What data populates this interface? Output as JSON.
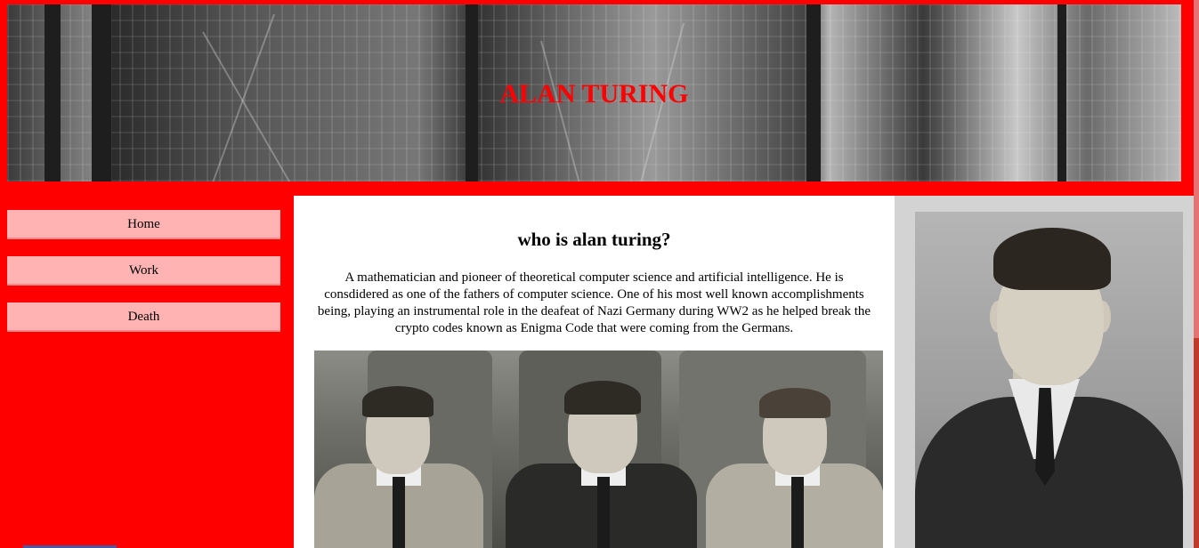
{
  "header": {
    "title": "ALAN TURING",
    "banner_image": "computer-machinery-photo"
  },
  "sidebar": {
    "items": [
      {
        "label": "Home"
      },
      {
        "label": "Work"
      },
      {
        "label": "Death"
      }
    ]
  },
  "main": {
    "heading": "who is alan turing?",
    "paragraph": "A mathematician and pioneer of theoretical computer science and artificial intelligence. He is consdidered as one of the fathers of computer science. One of his most well known accomplishments being, playing an instrumental role in the deafeat of Nazi Germany during WW2 as he helped break the crypto codes known as Enigma Code that were coming from the Germans.",
    "image": "school-group-photo"
  },
  "aside": {
    "image": "alan-turing-portrait"
  },
  "colors": {
    "page_background": "#ff0000",
    "title_color": "#ff0000",
    "nav_button": "#ffb3b3",
    "aside_background": "#d3d3d3",
    "main_background": "#ffffff"
  }
}
